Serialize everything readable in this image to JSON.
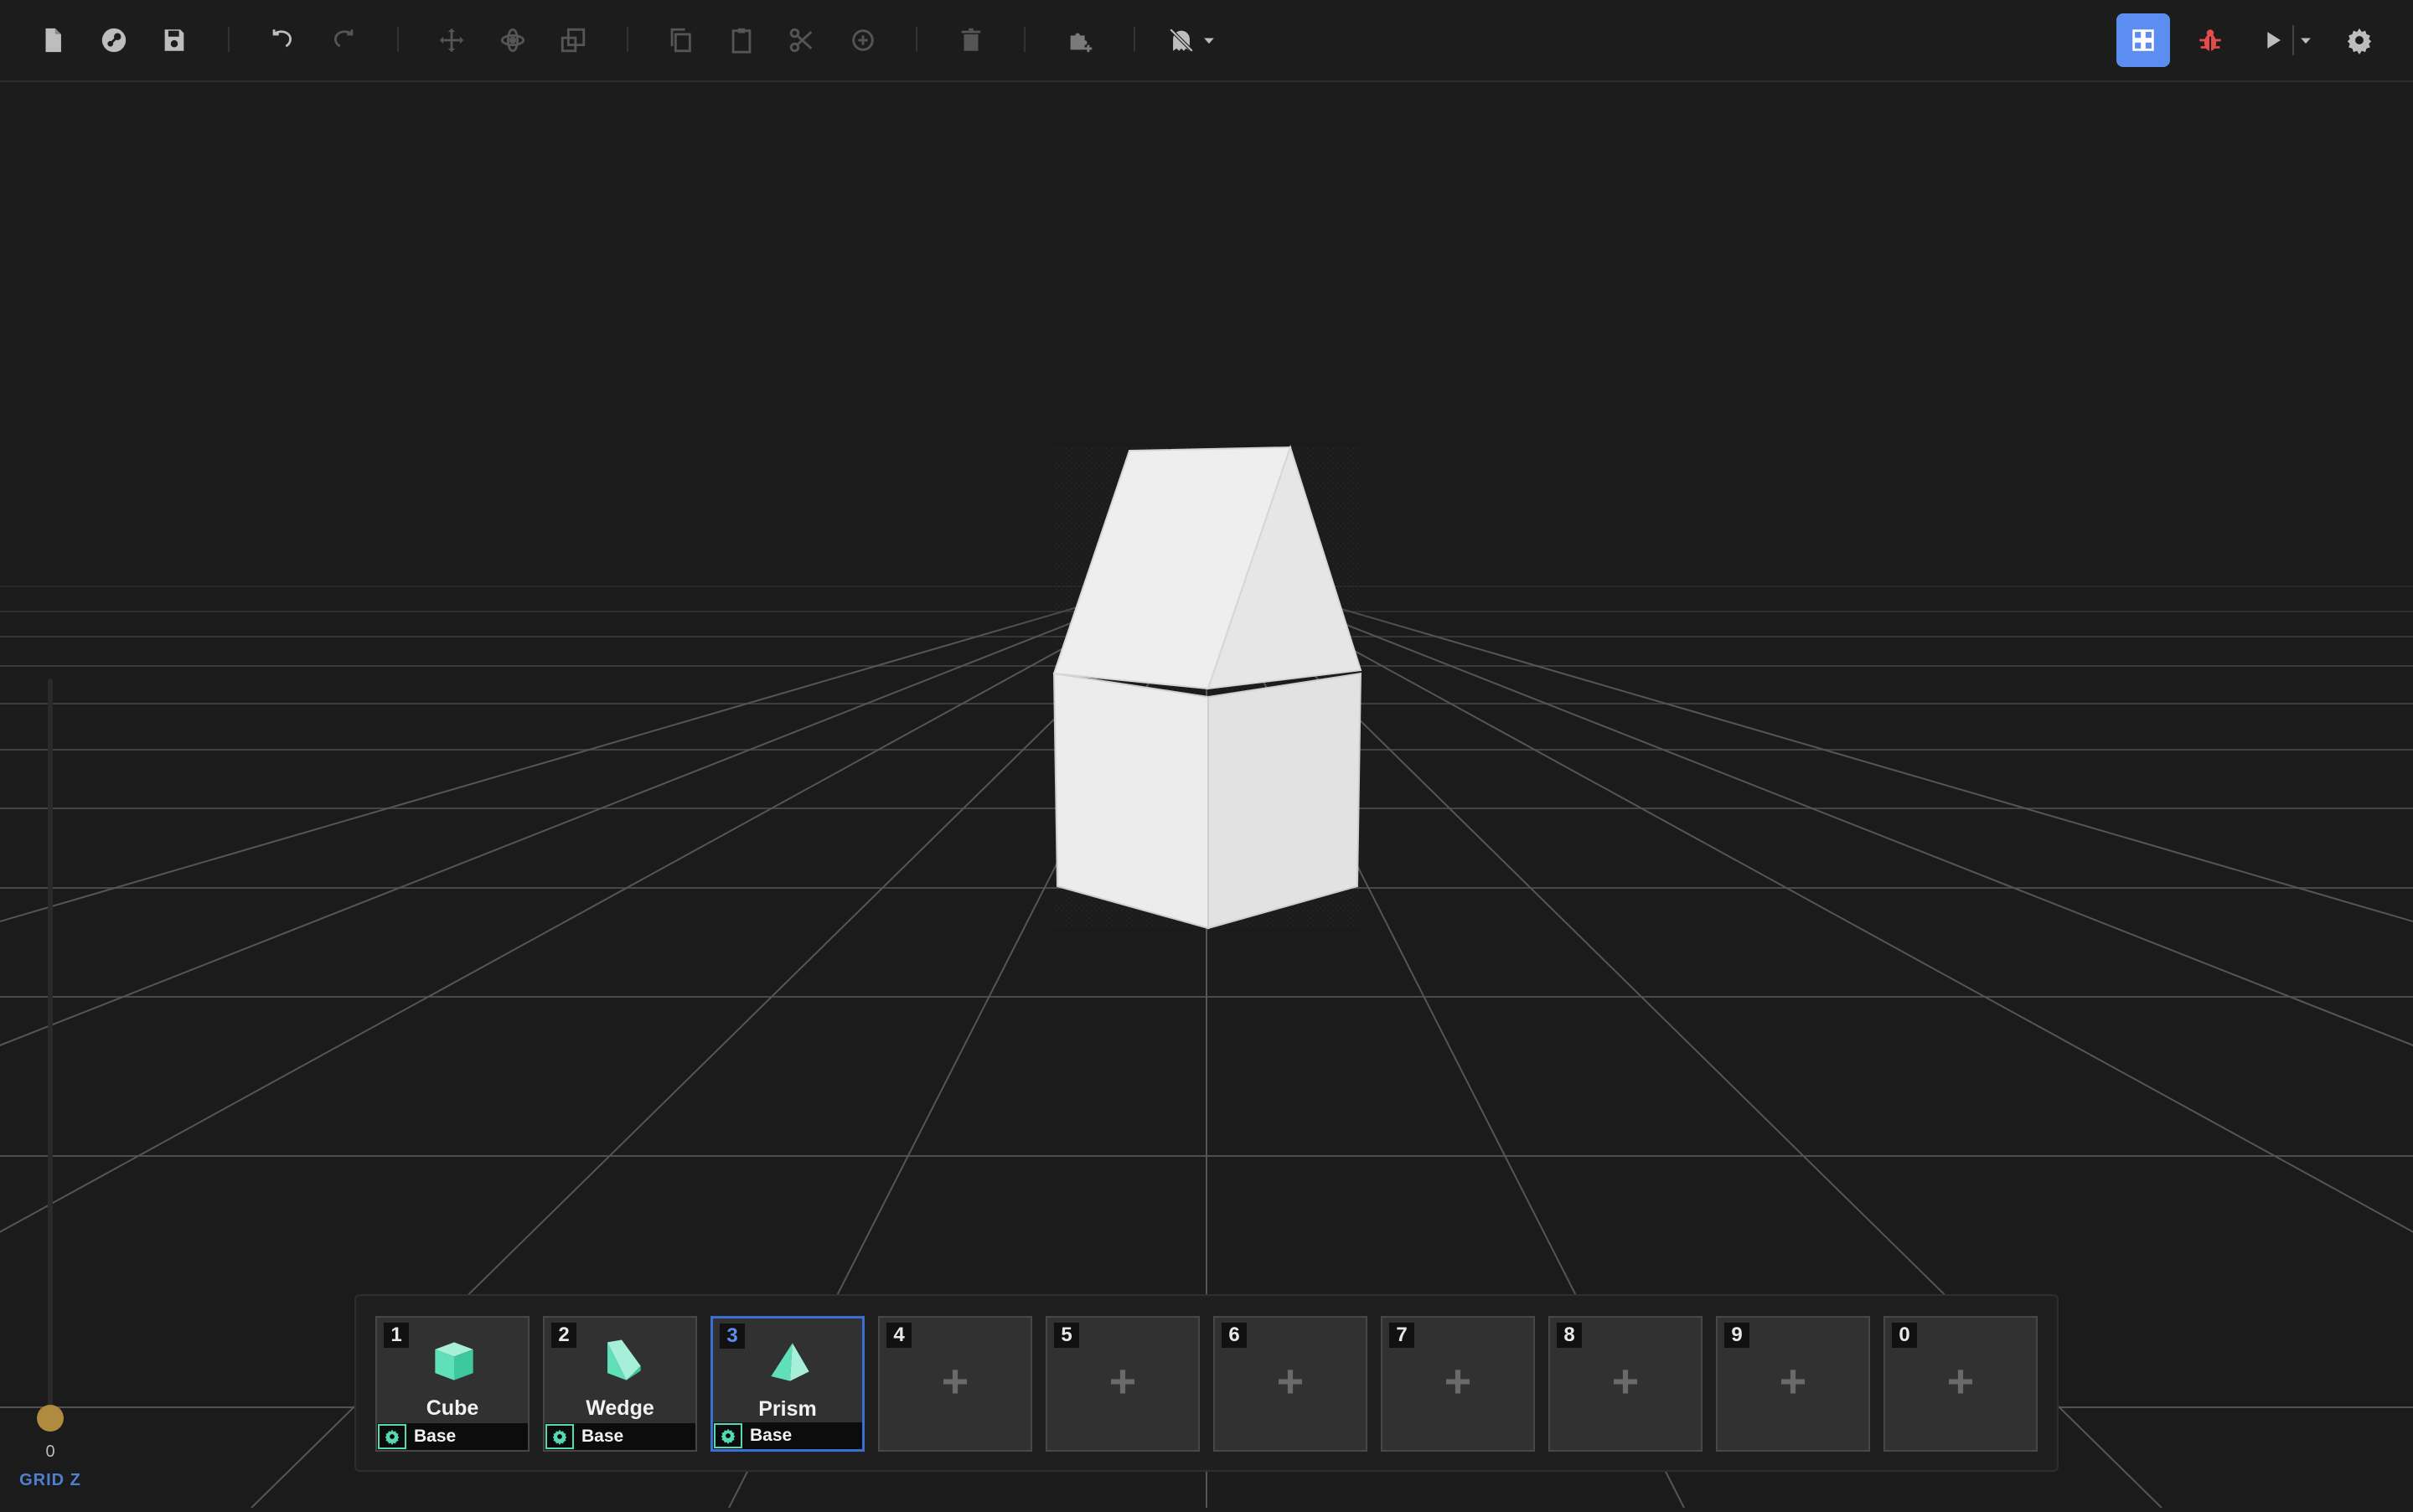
{
  "toolbar": {
    "left_buttons": [
      {
        "name": "new-file-icon"
      },
      {
        "name": "steam-icon"
      },
      {
        "name": "save-icon"
      },
      {
        "name": "undo-icon"
      },
      {
        "name": "redo-icon"
      },
      {
        "name": "move-icon"
      },
      {
        "name": "rotate-icon"
      },
      {
        "name": "scale-icon"
      },
      {
        "name": "copy-icon"
      },
      {
        "name": "paste-icon"
      },
      {
        "name": "cut-icon"
      },
      {
        "name": "duplicate-icon"
      },
      {
        "name": "delete-icon"
      },
      {
        "name": "puzzle-add-icon"
      },
      {
        "name": "ghost-hidden-icon"
      }
    ],
    "right_buttons": [
      {
        "name": "grid-view-icon",
        "active": true
      },
      {
        "name": "bug-icon"
      },
      {
        "name": "play-icon"
      },
      {
        "name": "settings-icon"
      }
    ],
    "accent": "#5b8ef0",
    "bug_color": "#e64b4b"
  },
  "grid_z": {
    "value": "0",
    "label": "GRID Z",
    "knob_color": "#b08a3e"
  },
  "hotbar": {
    "slots": [
      {
        "key": "1",
        "name": "Cube",
        "category": "Base",
        "icon": "cube-icon",
        "filled": true,
        "selected": false
      },
      {
        "key": "2",
        "name": "Wedge",
        "category": "Base",
        "icon": "wedge-icon",
        "filled": true,
        "selected": false
      },
      {
        "key": "3",
        "name": "Prism",
        "category": "Base",
        "icon": "prism-icon",
        "filled": true,
        "selected": true
      },
      {
        "key": "4",
        "plus": "+",
        "filled": false
      },
      {
        "key": "5",
        "plus": "+",
        "filled": false
      },
      {
        "key": "6",
        "plus": "+",
        "filled": false
      },
      {
        "key": "7",
        "plus": "+",
        "filled": false
      },
      {
        "key": "8",
        "plus": "+",
        "filled": false
      },
      {
        "key": "9",
        "plus": "+",
        "filled": false
      },
      {
        "key": "0",
        "plus": "+",
        "filled": false
      }
    ],
    "icon_color": "#5fe0b9",
    "selected_color": "#3c6fd6"
  },
  "scene": {
    "object": "house-shaped block (cube with prism roof)",
    "object_color": "#ececec",
    "grid_color": "#5a5a5a"
  }
}
